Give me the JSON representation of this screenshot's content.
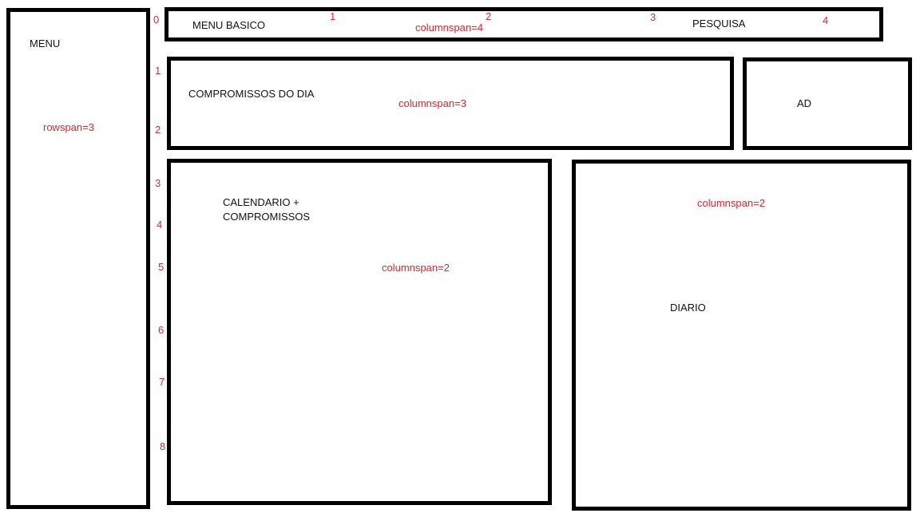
{
  "colors": {
    "border": "#000000",
    "annotation": "#e0242b",
    "text": "#111111",
    "background": "#ffffff"
  },
  "row_numbers": [
    "0",
    "1",
    "2",
    "3",
    "4",
    "5",
    "6",
    "7",
    "8"
  ],
  "column_numbers": [
    "1",
    "2",
    "3",
    "4"
  ],
  "menu": {
    "label": "MENU",
    "note": "rowspan=3"
  },
  "top_bar": {
    "label": "MENU BASICO",
    "search_label": "PESQUISA",
    "note": "columnspan=4"
  },
  "appointments_today": {
    "label": "COMPROMISSOS DO DIA",
    "note": "columnspan=3"
  },
  "ad": {
    "label": "AD"
  },
  "calendar": {
    "label_line1": "CALENDARIO +",
    "label_line2": "COMPROMISSOS",
    "note": "columnspan=2"
  },
  "diary": {
    "label": "DIARIO",
    "note": "columnspan=2"
  }
}
